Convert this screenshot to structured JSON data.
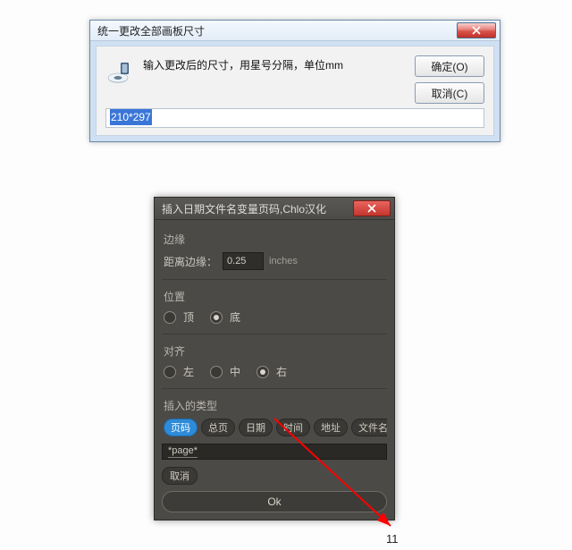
{
  "dialog1": {
    "title": "统一更改全部画板尺寸",
    "message": "输入更改后的尺寸，用星号分隔，单位mm",
    "input_value": "210*297",
    "ok_label": "确定(O)",
    "cancel_label": "取消(C)"
  },
  "dialog2": {
    "title": "插入日期文件名变量页码,Chlo汉化",
    "margin": {
      "group_label": "边缘",
      "field_label": "距离边缘：",
      "value": "0.25",
      "unit": "inches"
    },
    "position": {
      "group_label": "位置",
      "options": [
        {
          "label": "顶",
          "checked": false
        },
        {
          "label": "底",
          "checked": true
        }
      ]
    },
    "align": {
      "group_label": "对齐",
      "options": [
        {
          "label": "左",
          "checked": false
        },
        {
          "label": "中",
          "checked": false
        },
        {
          "label": "右",
          "checked": true
        }
      ]
    },
    "insert_types": {
      "group_label": "插入的类型",
      "items": [
        {
          "label": "页码",
          "active": true
        },
        {
          "label": "总页",
          "active": false
        },
        {
          "label": "日期",
          "active": false
        },
        {
          "label": "时间",
          "active": false
        },
        {
          "label": "地址",
          "active": false
        },
        {
          "label": "文件名",
          "active": false
        }
      ]
    },
    "template_value": "*page*",
    "cancel_label": "取消",
    "ok_label": "Ok"
  },
  "annotation": {
    "page_number": "11"
  },
  "colors": {
    "dark_bg": "#4b4a47",
    "pill_active": "#2e8bd8",
    "arrow": "#ff0000"
  }
}
